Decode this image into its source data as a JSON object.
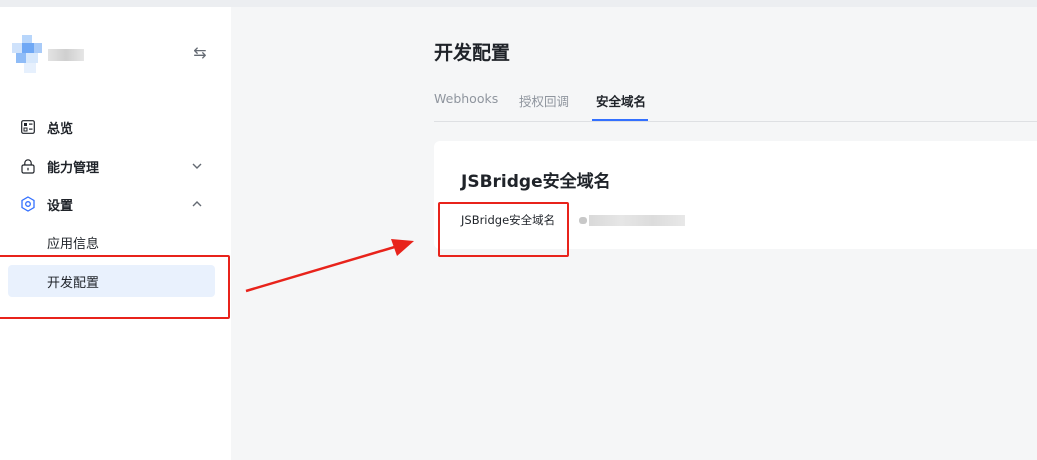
{
  "sidebar": {
    "collapse_glyph": "⇆",
    "items": [
      {
        "label": "总览",
        "icon": "dashboard-icon"
      },
      {
        "label": "能力管理",
        "icon": "lock-icon",
        "chevron": "chevron-down-icon"
      },
      {
        "label": "设置",
        "icon": "settings-icon",
        "chevron": "chevron-up-icon"
      }
    ],
    "sub_items": [
      {
        "label": "应用信息",
        "active": false
      },
      {
        "label": "开发配置",
        "active": true
      }
    ]
  },
  "main": {
    "title": "开发配置",
    "tabs": [
      {
        "label": "Webhooks",
        "active": false
      },
      {
        "label": "授权回调",
        "active": false
      },
      {
        "label": "安全域名",
        "active": true
      }
    ],
    "card": {
      "title": "JSBridge安全域名",
      "field_label": "JSBridge安全域名"
    }
  },
  "colors": {
    "accent": "#3370ff",
    "annotation": "#e8231b",
    "active_bg": "#e9f1fd"
  }
}
